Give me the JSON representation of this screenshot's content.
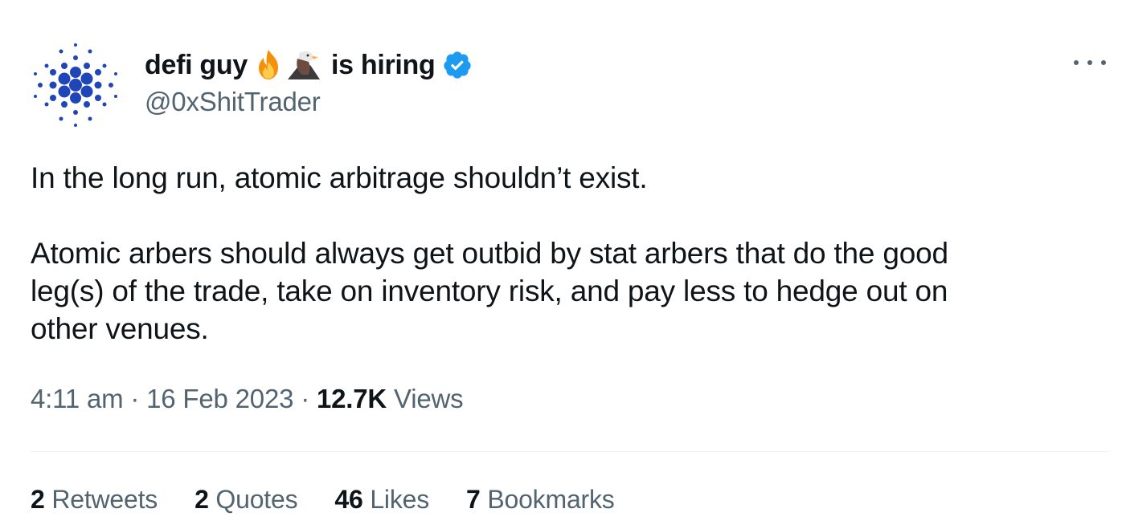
{
  "tweet": {
    "author": {
      "name_part1": "defi guy",
      "emojis": [
        "fire-emoji",
        "eagle-emoji"
      ],
      "name_part2": "is hiring",
      "verified": true,
      "handle": "@0xShitTrader",
      "avatar_icon": "cardano-logo-icon",
      "avatar_color": "#2045b8"
    },
    "text": {
      "paragraph1": "In the long run, atomic arbitrage shouldn’t exist.",
      "paragraph2": "Atomic arbers should always get outbid by stat arbers that do the good\nleg(s) of the trade, take on inventory risk, and pay less to hedge out on\nother venues."
    },
    "time": "4:11 am",
    "date": "16 Feb 2023",
    "separator": " · ",
    "views_count": "12.7K",
    "views_label": "Views",
    "stats": {
      "retweets_count": "2",
      "retweets_label": "Retweets",
      "quotes_count": "2",
      "quotes_label": "Quotes",
      "likes_count": "46",
      "likes_label": "Likes",
      "bookmarks_count": "7",
      "bookmarks_label": "Bookmarks"
    },
    "colors": {
      "text_primary": "#0f1419",
      "text_secondary": "#536471",
      "verified_blue": "#1d9bf0",
      "divider": "#eff3f4"
    }
  }
}
